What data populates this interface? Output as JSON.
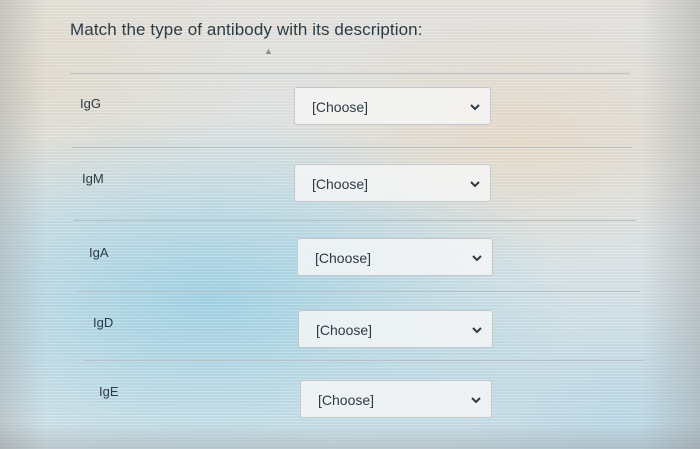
{
  "question": {
    "text": "Match the type of antibody with its description:"
  },
  "rows": [
    {
      "label": "IgG",
      "select": {
        "value": "[Choose]",
        "icon": "chevron-down-icon"
      }
    },
    {
      "label": "IgM",
      "select": {
        "value": "[Choose]",
        "icon": "chevron-down-icon"
      }
    },
    {
      "label": "IgA",
      "select": {
        "value": "[Choose]",
        "icon": "chevron-down-icon"
      }
    },
    {
      "label": "IgD",
      "select": {
        "value": "[Choose]",
        "icon": "chevron-down-icon"
      }
    },
    {
      "label": "IgE",
      "select": {
        "value": "[Choose]",
        "icon": "chevron-down-icon"
      }
    }
  ],
  "colors": {
    "text": "#2d3b45",
    "select_border": "#c4c8cb",
    "select_background": "#f6f7f7"
  }
}
